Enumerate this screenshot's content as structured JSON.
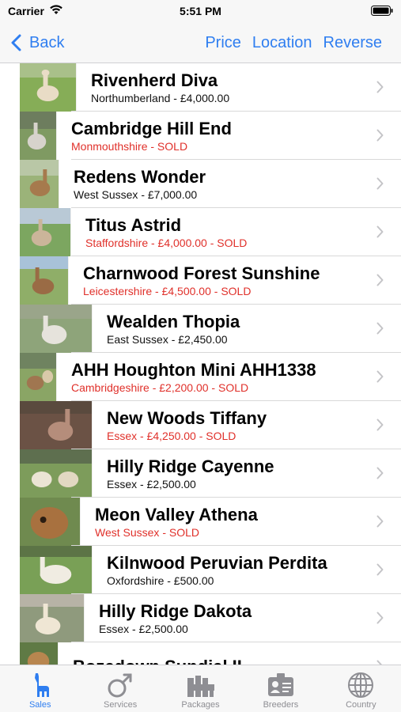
{
  "status": {
    "carrier": "Carrier",
    "time": "5:51 PM"
  },
  "nav": {
    "back_label": "Back",
    "actions": [
      "Price",
      "Location",
      "Reverse"
    ]
  },
  "colors": {
    "accent": "#2f7ef0",
    "sold": "#e0302a",
    "muted": "#8e8e93"
  },
  "listings": [
    {
      "name": "Rivenherd Diva",
      "details": "Northumberland - £4,000.00",
      "sold": false
    },
    {
      "name": "Cambridge Hill End",
      "details": "Monmouthshire - SOLD",
      "sold": true
    },
    {
      "name": "Redens Wonder",
      "details": "West Sussex - £7,000.00",
      "sold": false
    },
    {
      "name": "Titus Astrid",
      "details": "Staffordshire - £4,000.00 - SOLD",
      "sold": true
    },
    {
      "name": "Charnwood Forest Sunshine",
      "details": "Leicestershire - £4,500.00 - SOLD",
      "sold": true
    },
    {
      "name": "Wealden Thopia",
      "details": "East Sussex - £2,450.00",
      "sold": false
    },
    {
      "name": "AHH Houghton Mini AHH1338",
      "details": "Cambridgeshire - £2,200.00 - SOLD",
      "sold": true
    },
    {
      "name": "New Woods Tiffany",
      "details": "Essex - £4,250.00 - SOLD",
      "sold": true
    },
    {
      "name": "Hilly Ridge Cayenne",
      "details": "Essex - £2,500.00",
      "sold": false
    },
    {
      "name": "Meon Valley Athena",
      "details": "West Sussex - SOLD",
      "sold": true
    },
    {
      "name": "Kilnwood Peruvian Perdita",
      "details": "Oxfordshire - £500.00",
      "sold": false
    },
    {
      "name": "Hilly Ridge Dakota",
      "details": "Essex - £2,500.00",
      "sold": false
    },
    {
      "name": "Bozedown Sundial II",
      "details": "",
      "sold": false
    }
  ],
  "tabs": [
    {
      "label": "Sales",
      "icon": "alpaca-icon",
      "active": true
    },
    {
      "label": "Services",
      "icon": "male-symbol-icon",
      "active": false
    },
    {
      "label": "Packages",
      "icon": "alpaca-group-icon",
      "active": false
    },
    {
      "label": "Breeders",
      "icon": "id-card-icon",
      "active": false
    },
    {
      "label": "Country",
      "icon": "globe-icon",
      "active": false
    }
  ]
}
